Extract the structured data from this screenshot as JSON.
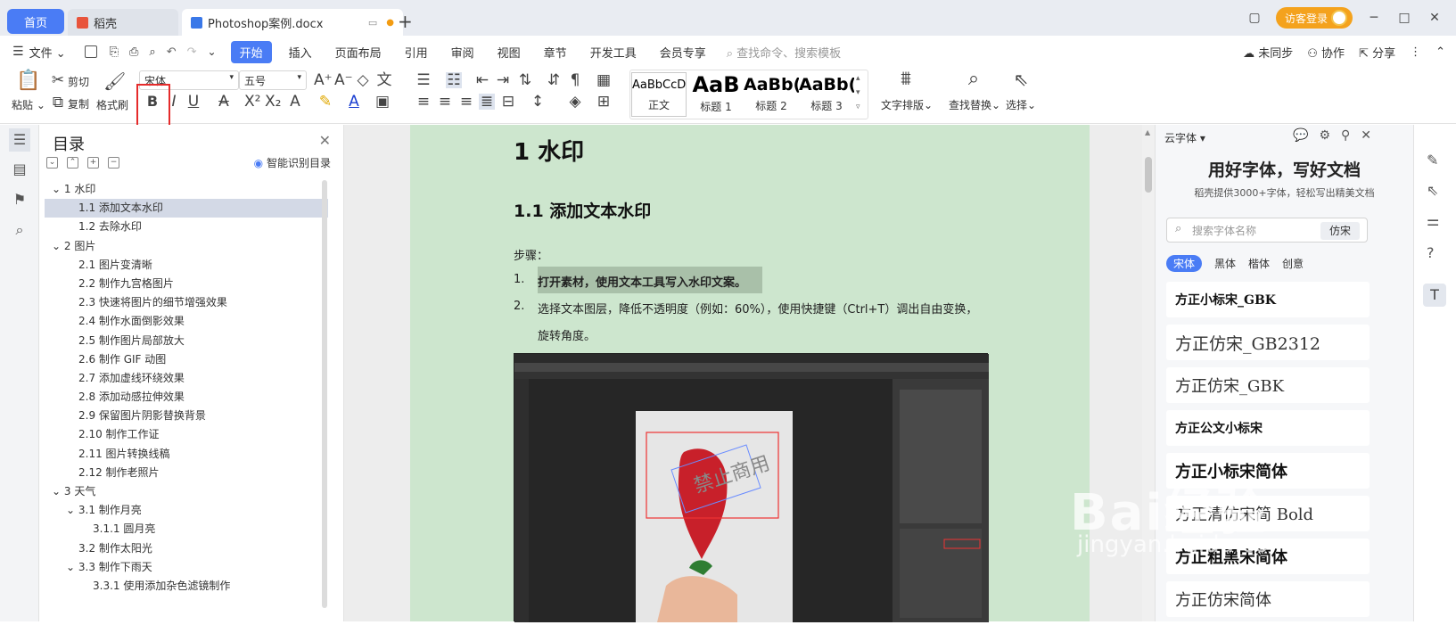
{
  "tabs": {
    "home": "首页",
    "daoke": "稻壳",
    "doc": "Photoshop案例.docx",
    "add": "+"
  },
  "titlebar": {
    "visitor_login": "访客登录"
  },
  "menu": {
    "file": "文件",
    "items": [
      "开始",
      "插入",
      "页面布局",
      "引用",
      "审阅",
      "视图",
      "章节",
      "开发工具",
      "会员专享"
    ],
    "search": "查找命令、搜索模板",
    "right": [
      "未同步",
      "协作",
      "分享"
    ]
  },
  "ribbon": {
    "paste": "粘贴",
    "cut": "剪切",
    "copy": "复制",
    "format_painter": "格式刷",
    "font_name": "宋体",
    "font_size": "五号",
    "bold": "B",
    "italic": "I",
    "underline": "U",
    "styles": [
      {
        "sample": "AaBbCcDd",
        "name": "正文"
      },
      {
        "sample": "AaB",
        "name": "标题 1"
      },
      {
        "sample": "AaBb(",
        "name": "标题 2"
      },
      {
        "sample": "AaBb(",
        "name": "标题 3"
      }
    ],
    "text_layout": "文字排版",
    "find_replace": "查找替换",
    "select": "选择"
  },
  "toc": {
    "title": "目录",
    "smart": "智能识别目录",
    "items": [
      {
        "label": "1 水印",
        "level": 1,
        "expanded": true
      },
      {
        "label": "1.1 添加文本水印",
        "level": 2,
        "selected": true
      },
      {
        "label": "1.2 去除水印",
        "level": 2
      },
      {
        "label": "2 图片",
        "level": 1,
        "expanded": true
      },
      {
        "label": "2.1 图片变清晰",
        "level": 2
      },
      {
        "label": "2.2 制作九宫格图片",
        "level": 2
      },
      {
        "label": "2.3 快速将图片的细节增强效果",
        "level": 2
      },
      {
        "label": "2.4 制作水面倒影效果",
        "level": 2
      },
      {
        "label": "2.5 制作图片局部放大",
        "level": 2
      },
      {
        "label": "2.6 制作 GIF 动图",
        "level": 2
      },
      {
        "label": "2.7 添加虚线环绕效果",
        "level": 2
      },
      {
        "label": "2.8 添加动感拉伸效果",
        "level": 2
      },
      {
        "label": "2.9 保留图片阴影替换背景",
        "level": 2
      },
      {
        "label": "2.10 制作工作证",
        "level": 2
      },
      {
        "label": "2.11 图片转换线稿",
        "level": 2
      },
      {
        "label": "2.12 制作老照片",
        "level": 2
      },
      {
        "label": "3 天气",
        "level": 1,
        "expanded": true
      },
      {
        "label": "3.1 制作月亮",
        "level": 2,
        "expanded": true
      },
      {
        "label": "3.1.1 圆月亮",
        "level": 3
      },
      {
        "label": "3.2 制作太阳光",
        "level": 2
      },
      {
        "label": "3.3 制作下雨天",
        "level": 2,
        "expanded": true
      },
      {
        "label": "3.3.1 使用添加杂色滤镜制作",
        "level": 3
      }
    ]
  },
  "document": {
    "h1": "1 水印",
    "h2": "1.1 添加文本水印",
    "steps_label": "步骤：",
    "step1_num": "1.",
    "step1": "打开素材，使用文本工具写入水印文案。",
    "step2_num": "2.",
    "step2_line1": "选择文本图层，降低不透明度（例如：60%），使用快捷键（Ctrl+T）调出自由变换，",
    "step2_line2": "旋转角度。"
  },
  "font_panel": {
    "tab": "云字体",
    "headline": "用好字体，写好文档",
    "sub": "稻壳提供3000+字体，轻松写出精美文档",
    "search_placeholder": "搜索字体名称",
    "search_btn": "仿宋",
    "categories": [
      "宋体",
      "黑体",
      "楷体",
      "创意"
    ],
    "fonts": [
      "方正小标宋_GBK",
      "方正仿宋_GB2312",
      "方正仿宋_GBK",
      "方正公文小标宋",
      "方正小标宋简体",
      "方正清仿宋简 Bold",
      "方正粗黑宋简体",
      "方正仿宋简体"
    ]
  },
  "watermark": {
    "line1": "Bai经验",
    "line2": "jingyan.baidu.com"
  },
  "colors": {
    "accent": "#4a7cf5",
    "page_bg": "#cde6ce",
    "highlight_red": "#e52b2b",
    "vip_orange": "#f4a21d"
  }
}
